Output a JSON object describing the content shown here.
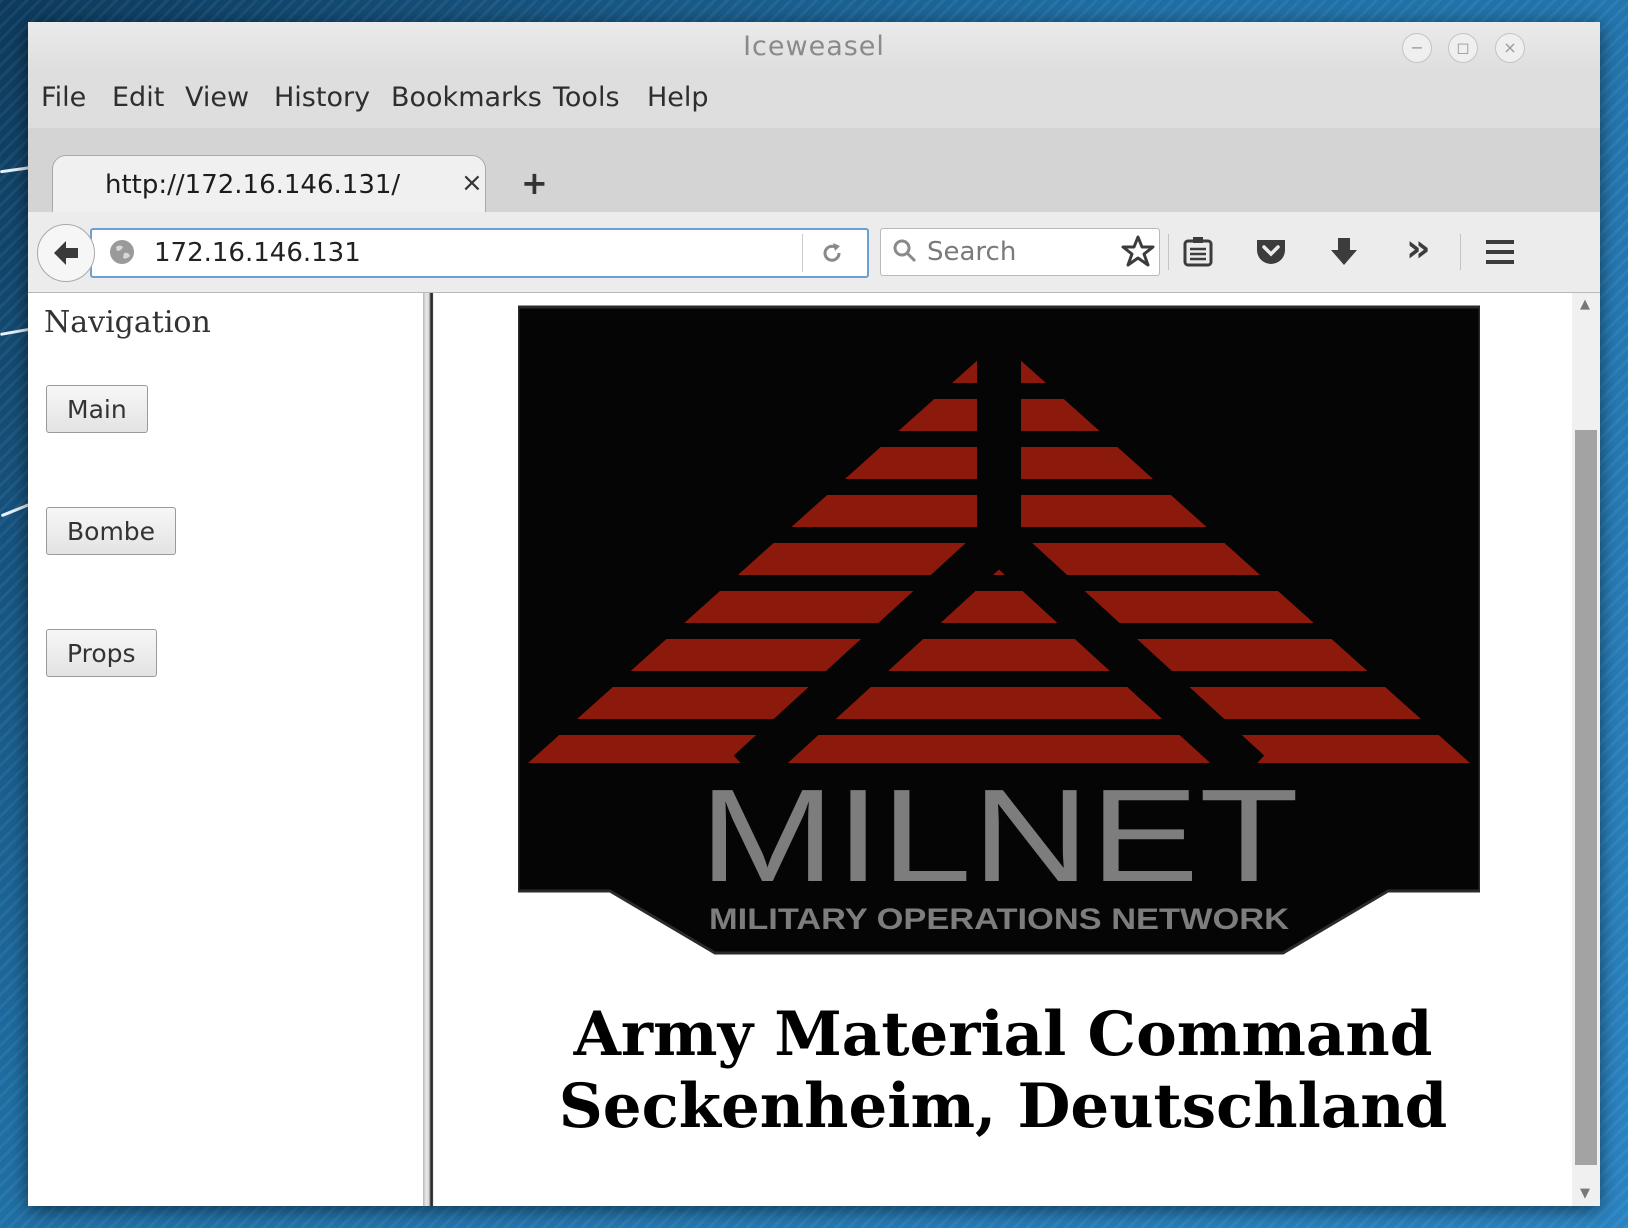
{
  "window": {
    "title": "Iceweasel",
    "controls": {
      "minimize": "−",
      "maximize": "◻",
      "close": "×"
    }
  },
  "menu": {
    "items": [
      {
        "label": "File"
      },
      {
        "label": "Edit"
      },
      {
        "label": "View"
      },
      {
        "label": "History"
      },
      {
        "label": "Bookmarks"
      },
      {
        "label": "Tools"
      },
      {
        "label": "Help"
      }
    ]
  },
  "tab": {
    "title": "http://172.16.146.131/",
    "close": "×",
    "new_tab": "+"
  },
  "toolbar": {
    "url": "172.16.146.131",
    "search_placeholder": "Search",
    "overflow": "»",
    "icons": [
      "back-icon",
      "globe-icon",
      "reload-icon",
      "search-icon",
      "bookmark-star-icon",
      "reading-list-icon",
      "pocket-icon",
      "download-icon",
      "overflow-icon",
      "hamburger-menu-icon"
    ]
  },
  "sidebar": {
    "heading": "Navigation",
    "buttons": [
      {
        "label": "Main"
      },
      {
        "label": "Bombe"
      },
      {
        "label": "Props"
      }
    ]
  },
  "main": {
    "logo": {
      "title": "MILNET",
      "subtitle": "MILITARY OPERATIONS NETWORK"
    },
    "heading_line1": "Army Material Command",
    "heading_line2": "Seckenheim, Deutschland"
  },
  "colors": {
    "logo_red": "#8c1a0c",
    "logo_gray": "#7d7d7d",
    "urlbar_focus": "#6d9fd4",
    "desktop": "#1f6fa5"
  }
}
